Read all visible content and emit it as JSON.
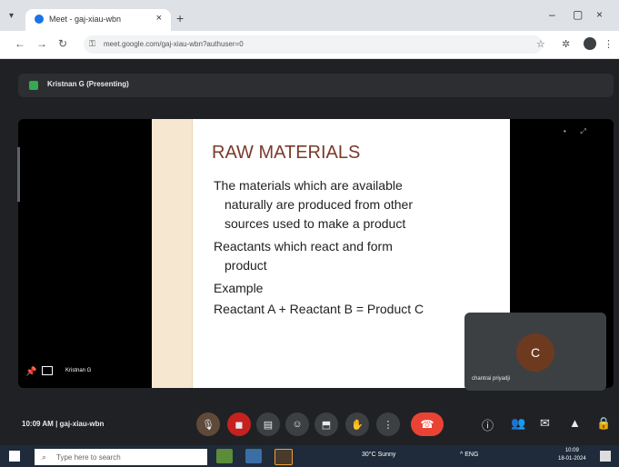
{
  "browser": {
    "tab_title": "Meet - gaj-xiau-wbn",
    "url": "meet.google.com/gaj-xiau-wbn?authuser=0"
  },
  "meet": {
    "presenter_banner": "Kristnan G (Presenting)",
    "presenter_tile_name": "Kristnan G",
    "participant_initial": "C",
    "participant_name": "chantrai priyadji",
    "time": "10:09 AM",
    "meeting_code": "gaj-xiau-wbn"
  },
  "slide": {
    "title": "RAW MATERIALS",
    "lines": [
      "The materials which are available",
      "naturally are produced from other",
      "sources used to make a product",
      "Reactants which react and form",
      "product",
      "Example",
      "Reactant A + Reactant B = Product C"
    ]
  },
  "taskbar": {
    "search_placeholder": "Type here to search",
    "weather": "30°C Sunny",
    "tray": "^ ENG",
    "clock_time": "10:09",
    "clock_date": "18-01-2024"
  },
  "icons": [
    "chrome-favicon",
    "new-tab-icon",
    "back-icon",
    "forward-icon",
    "reload-icon",
    "star-icon",
    "extensions-icon",
    "more-icon",
    "mic-icon",
    "camera-icon",
    "captions-icon",
    "emoji-icon",
    "present-icon",
    "hand-icon",
    "more-options-icon",
    "end-call-icon",
    "info-icon",
    "people-icon",
    "chat-icon",
    "activities-icon",
    "host-controls-icon",
    "windows-icon",
    "search-icon"
  ]
}
